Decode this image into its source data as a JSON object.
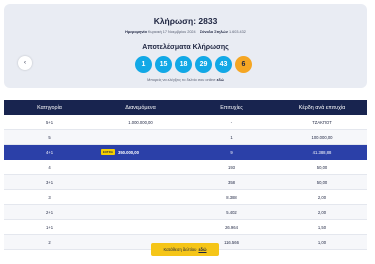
{
  "draw": {
    "title": "Κλήρωση: 2833",
    "date_label": "Ημερομηνία",
    "date_value": "Κυριακή 17 Νοεμβρίου 2024",
    "columns_label": "Σύνολο Στηλών",
    "columns_value": "1.603.432"
  },
  "results": {
    "title": "Αποτελέσματα Κλήρωσης",
    "numbers": [
      "1",
      "15",
      "18",
      "29",
      "43"
    ],
    "joker": "6",
    "note_prefix": "Μπορείς να ελέγξεις το δελτίο σου online",
    "note_link": "εδώ"
  },
  "table": {
    "headers": [
      "Κατηγορία",
      "Διανεμόμενα",
      "Επιτυχίες",
      "Κέρδη ανά επιτυχία"
    ],
    "rows": [
      {
        "category": "5+1",
        "distributed": "1.000.000,00",
        "winners": "-",
        "prize": "ΤΖΑΚΠΟΤ",
        "badge": ""
      },
      {
        "category": "5",
        "distributed": "",
        "winners": "1",
        "prize": "100.000,00",
        "badge": ""
      },
      {
        "category": "4+1",
        "distributed": "350.000,00",
        "winners": "9",
        "prize": "41.388,88",
        "badge": "EXTRA"
      },
      {
        "category": "4",
        "distributed": "",
        "winners": "193",
        "prize": "50,00",
        "badge": ""
      },
      {
        "category": "3+1",
        "distributed": "",
        "winners": "358",
        "prize": "50,00",
        "badge": ""
      },
      {
        "category": "3",
        "distributed": "",
        "winners": "8.388",
        "prize": "2,00",
        "badge": ""
      },
      {
        "category": "2+1",
        "distributed": "",
        "winners": "5.402",
        "prize": "2,00",
        "badge": ""
      },
      {
        "category": "1+1",
        "distributed": "",
        "winners": "26.964",
        "prize": "1,50",
        "badge": ""
      },
      {
        "category": "2",
        "distributed": "",
        "winners": "116.566",
        "prize": "1,00",
        "badge": ""
      }
    ]
  },
  "cta": {
    "label": "Κατάθεση δελτίου",
    "link": "εδώ"
  }
}
